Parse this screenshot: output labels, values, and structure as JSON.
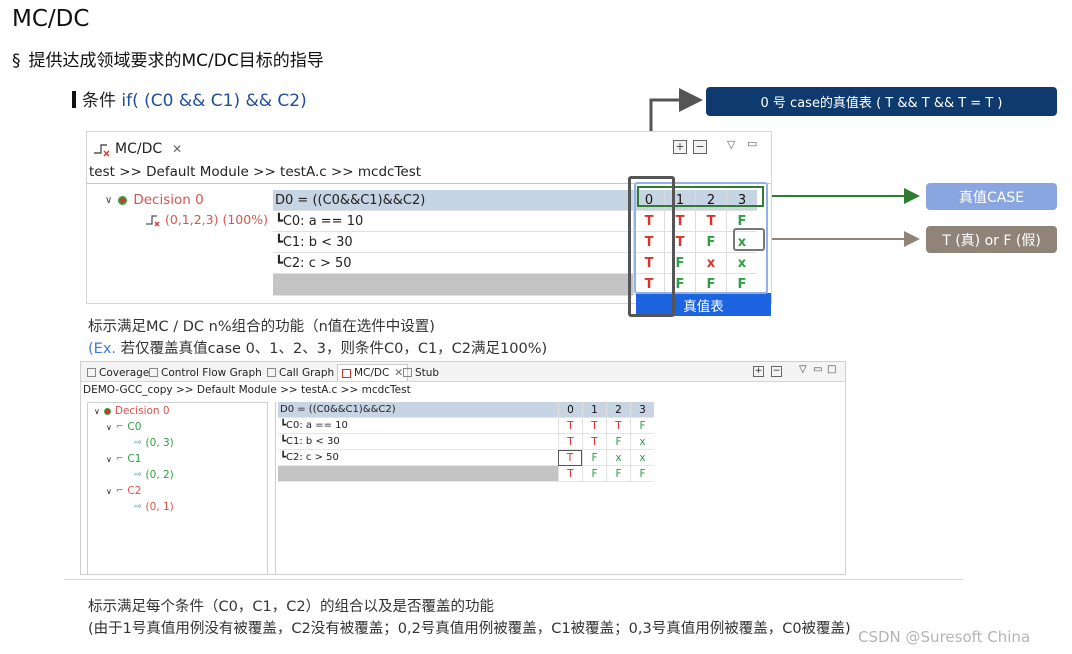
{
  "slide": {
    "title": "MC/DC",
    "bullet_mark": "§",
    "bullet_text": "提供达成领域要求的MC/DC目标的指导",
    "condition_prefix": "条件 ",
    "condition_code": "if( (C0 && C1) && C2)",
    "mid_text1": "标示满足MC / DC n%组合的功能（n值在选件中设置)",
    "mid_text2_ex": "(Ex.",
    "mid_text2_rest": " 若仅覆盖真值case 0、1、2、3，则条件C0，C1，C2满足100%)",
    "bottom_text1": "标示满足每个条件（C0，C1，C2）的组合以及是否覆盖的功能",
    "bottom_text2": "(由于1号真值用例没有被覆盖，C2没有被覆盖；0,2号真值用例被覆盖，C1被覆盖；0,3号真值用例被覆盖，C0被覆盖)",
    "watermark": "CSDN @Suresoft China"
  },
  "callouts": {
    "case0": "0 号 case的真值表 ( T && T && T = T )",
    "true_case": "真值CASE",
    "t_or_f": "T (真)  or F (假)",
    "truth_table": "真值表"
  },
  "colors": {
    "navy": "#0f3a6e",
    "callout_blue": "#8aa6e0",
    "callout_gray": "#8f8477",
    "true_red": "#d9332a",
    "false_green": "#2f9e44",
    "truth_table_blue": "#1c64e0"
  },
  "shot1": {
    "tab_label": "MC/DC",
    "tab_close": "✕",
    "breadcrumb": "test >> Default Module >> testA.c >> mcdcTest",
    "tree_decision": "Decision 0",
    "tree_sub": "(0,1,2,3) (100%)",
    "tool_plus": "+",
    "tool_minus": "−",
    "tool_menu": "▽",
    "tool_min": "▭",
    "expr_header": "D0 = ((C0&&C1)&&C2)",
    "rows": [
      {
        "label": "C0: a == 10",
        "values": [
          "T",
          "T",
          "T",
          "F"
        ]
      },
      {
        "label": "C1: b < 30",
        "values": [
          "T",
          "T",
          "F",
          "x"
        ]
      },
      {
        "label": "C2: c > 50",
        "values": [
          "T",
          "F",
          "x",
          "x"
        ]
      }
    ],
    "columns": [
      "0",
      "1",
      "2",
      "3"
    ],
    "result": [
      "T",
      "F",
      "F",
      "F"
    ]
  },
  "shot2": {
    "tabs": [
      {
        "label": "Coverage",
        "icon": "coverage-icon"
      },
      {
        "label": "Control Flow Graph",
        "icon": "flow-graph-icon"
      },
      {
        "label": "Call Graph",
        "icon": "call-graph-icon"
      },
      {
        "label": "MC/DC",
        "icon": "mcdc-icon"
      },
      {
        "label": "Stub",
        "icon": "stub-icon"
      }
    ],
    "tab_close": "✕",
    "breadcrumb": "DEMO-GCC_copy >> Default Module >> testA.c >> mcdcTest",
    "tree": [
      {
        "label": "Decision 0",
        "color": "red"
      },
      {
        "label": "C0",
        "color": "green"
      },
      {
        "label": "(0, 3)",
        "color": "green"
      },
      {
        "label": "C1",
        "color": "green"
      },
      {
        "label": "(0, 2)",
        "color": "green"
      },
      {
        "label": "C2",
        "color": "red"
      },
      {
        "label": "(0, 1)",
        "color": "red"
      }
    ],
    "expr_header": "D0 = ((C0&&C1)&&C2)",
    "rows": [
      {
        "label": "C0: a == 10",
        "values": [
          "T",
          "T",
          "T",
          "F"
        ]
      },
      {
        "label": "C1: b < 30",
        "values": [
          "T",
          "T",
          "F",
          "x"
        ]
      },
      {
        "label": "C2: c > 50",
        "values": [
          "T",
          "F",
          "x",
          "x"
        ]
      }
    ],
    "columns": [
      "0",
      "1",
      "2",
      "3"
    ],
    "result": [
      "T",
      "F",
      "F",
      "F"
    ]
  }
}
